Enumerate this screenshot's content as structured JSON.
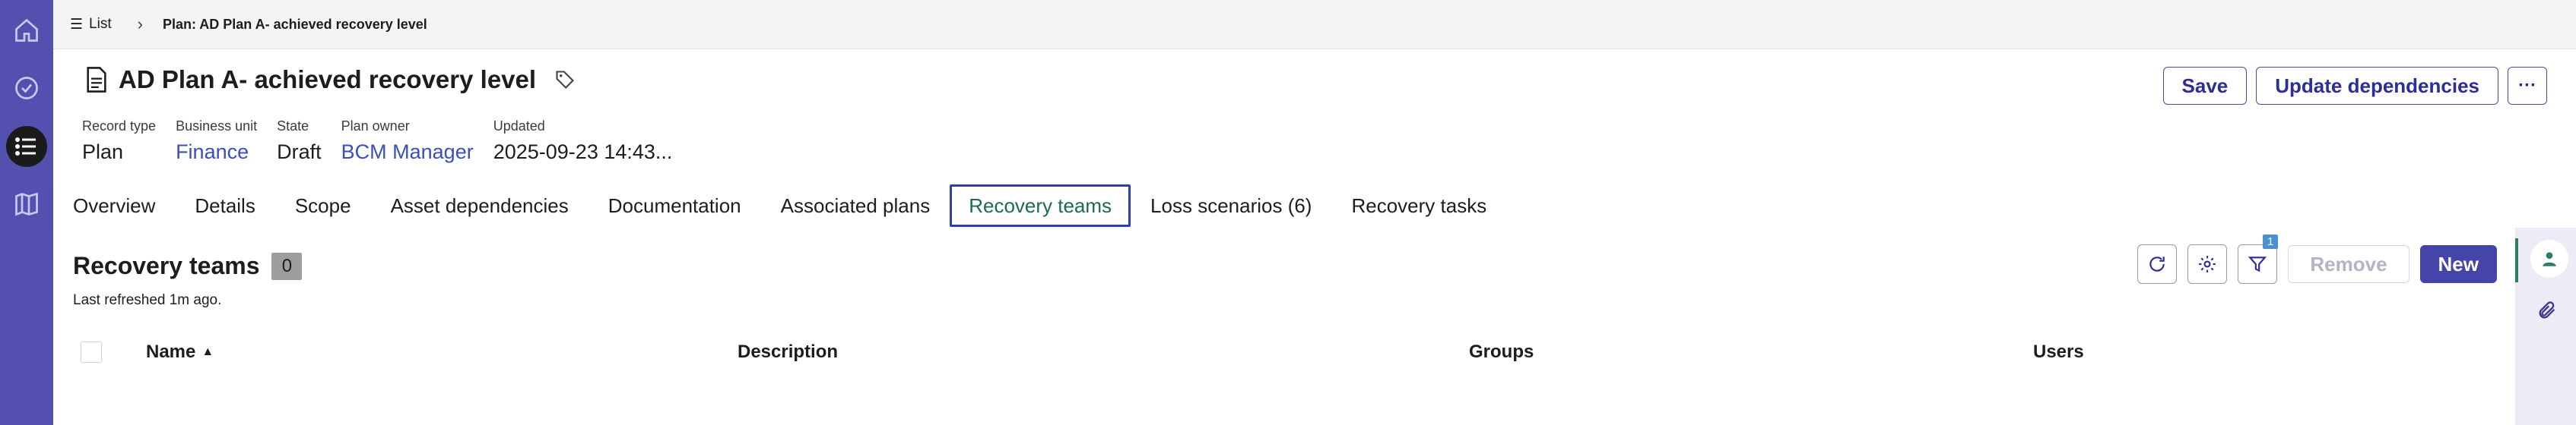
{
  "breadcrumb": {
    "list_label": "List",
    "current": "Plan: AD Plan A- achieved recovery level"
  },
  "record": {
    "title": "AD Plan A- achieved recovery level",
    "fields": [
      {
        "label": "Record type",
        "value": "Plan",
        "link": false
      },
      {
        "label": "Business unit",
        "value": "Finance",
        "link": true
      },
      {
        "label": "State",
        "value": "Draft",
        "link": false
      },
      {
        "label": "Plan owner",
        "value": "BCM Manager",
        "link": true
      },
      {
        "label": "Updated",
        "value": "2025-09-23 14:43...",
        "link": false
      }
    ]
  },
  "header_actions": {
    "save": "Save",
    "update_dependencies": "Update dependencies",
    "more": "···"
  },
  "tabs": [
    {
      "label": "Overview",
      "active": false
    },
    {
      "label": "Details",
      "active": false
    },
    {
      "label": "Scope",
      "active": false
    },
    {
      "label": "Asset dependencies",
      "active": false
    },
    {
      "label": "Documentation",
      "active": false
    },
    {
      "label": "Associated plans",
      "active": false
    },
    {
      "label": "Recovery teams",
      "active": true
    },
    {
      "label": "Loss scenarios (6)",
      "active": false
    },
    {
      "label": "Recovery tasks",
      "active": false
    }
  ],
  "list": {
    "title": "Recovery teams",
    "count": "0",
    "last_refreshed": "Last refreshed 1m ago.",
    "filter_badge": "1",
    "remove_label": "Remove",
    "new_label": "New",
    "columns": [
      "Name",
      "Description",
      "Groups",
      "Users"
    ]
  },
  "colors": {
    "rail": "#5350b0",
    "primary": "#4544a8",
    "link": "#3a4fb8",
    "active_tab_text": "#1d6b4a"
  }
}
